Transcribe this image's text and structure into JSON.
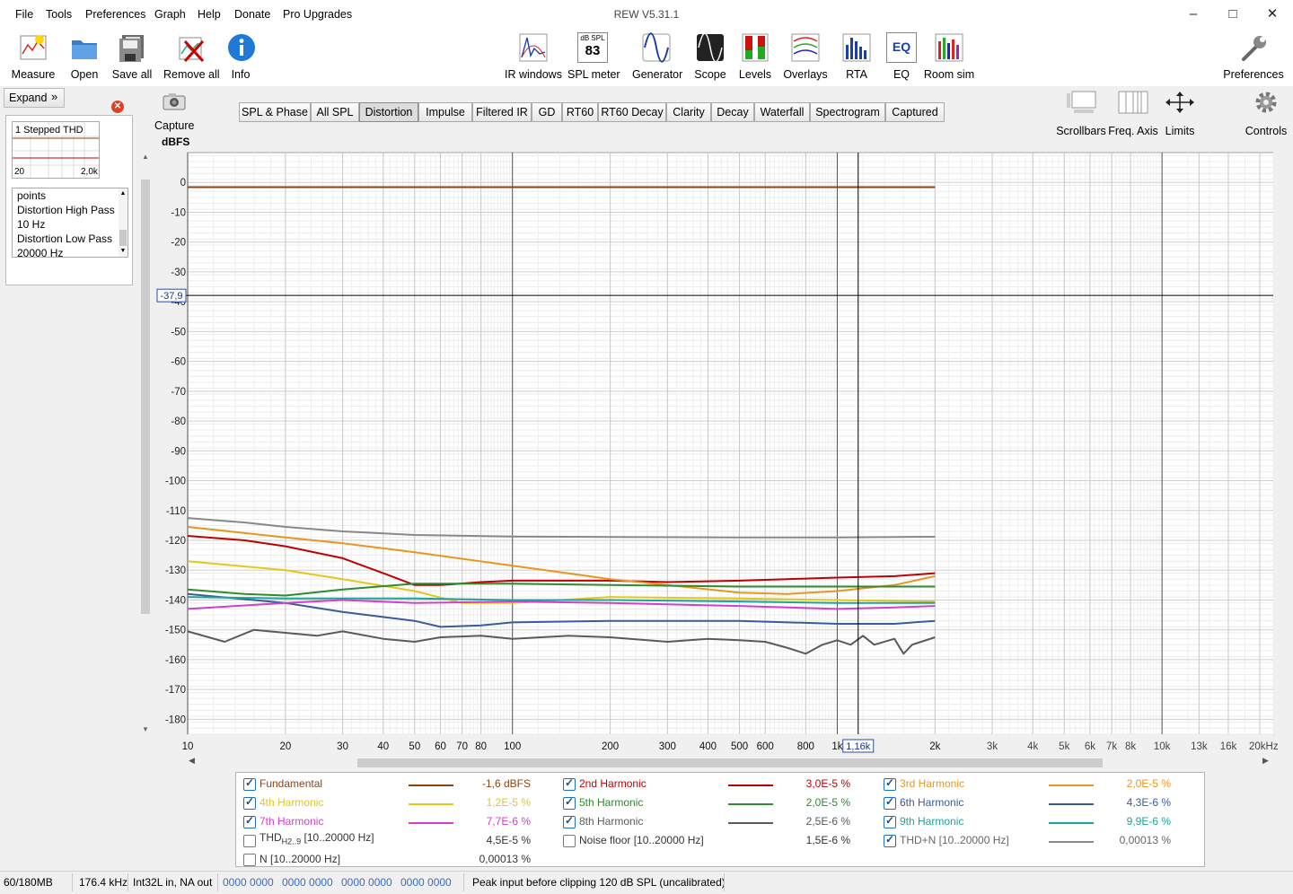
{
  "window": {
    "title": "REW V5.31.1",
    "menu": [
      "File",
      "Tools",
      "Preferences",
      "Graph",
      "Help",
      "Donate",
      "Pro Upgrades"
    ]
  },
  "toolbar": {
    "left": [
      "Measure",
      "Open",
      "Save all",
      "Remove all",
      "Info"
    ],
    "center": [
      "IR windows",
      "SPL meter",
      "Generator",
      "Scope",
      "Levels",
      "Overlays",
      "RTA",
      "EQ",
      "Room sim"
    ],
    "spl_icon_top": "dB SPL",
    "spl_icon_value": "83",
    "eq_icon": "EQ",
    "right": "Preferences"
  },
  "left_panel": {
    "expand": "Expand",
    "measurement_name": "1 Stepped THD",
    "thumb_x_left": "20",
    "thumb_x_right": "2,0k",
    "notes": [
      "points",
      "Distortion High Pass",
      "10 Hz",
      "Distortion Low Pass",
      "20000 Hz"
    ]
  },
  "capture": "Capture",
  "tabs": [
    "SPL & Phase",
    "All SPL",
    "Distortion",
    "Impulse",
    "Filtered IR",
    "GD",
    "RT60",
    "RT60 Decay",
    "Clarity",
    "Decay",
    "Waterfall",
    "Spectrogram",
    "Captured"
  ],
  "active_tab": "Distortion",
  "right_tools": [
    "Scrollbars",
    "Freq. Axis",
    "Limits",
    "Controls"
  ],
  "chart_data": {
    "type": "line",
    "ylabel": "dBFS",
    "xlabel": "",
    "x_scale": "log",
    "xlim": [
      10,
      22000
    ],
    "ylim": [
      -185,
      10
    ],
    "grid": true,
    "y_ticks": [
      "0",
      "-10",
      "-20",
      "-30",
      "-40",
      "-50",
      "-60",
      "-70",
      "-80",
      "-90",
      "-100",
      "-110",
      "-120",
      "-130",
      "-140",
      "-150",
      "-160",
      "-170",
      "-180"
    ],
    "x_ticks": [
      {
        "f": 10,
        "label": "10"
      },
      {
        "f": 20,
        "label": "20"
      },
      {
        "f": 30,
        "label": "30"
      },
      {
        "f": 40,
        "label": "40"
      },
      {
        "f": 50,
        "label": "50"
      },
      {
        "f": 60,
        "label": "60"
      },
      {
        "f": 70,
        "label": "70"
      },
      {
        "f": 80,
        "label": "80"
      },
      {
        "f": 100,
        "label": "100"
      },
      {
        "f": 200,
        "label": "200"
      },
      {
        "f": 300,
        "label": "300"
      },
      {
        "f": 400,
        "label": "400"
      },
      {
        "f": 500,
        "label": "500"
      },
      {
        "f": 600,
        "label": "600"
      },
      {
        "f": 800,
        "label": "800"
      },
      {
        "f": 1000,
        "label": "1k"
      },
      {
        "f": 2000,
        "label": "2k"
      },
      {
        "f": 3000,
        "label": "3k"
      },
      {
        "f": 4000,
        "label": "4k"
      },
      {
        "f": 5000,
        "label": "5k"
      },
      {
        "f": 6000,
        "label": "6k"
      },
      {
        "f": 7000,
        "label": "7k"
      },
      {
        "f": 8000,
        "label": "8k"
      },
      {
        "f": 10000,
        "label": "10k"
      },
      {
        "f": 13000,
        "label": "13k"
      },
      {
        "f": 16000,
        "label": "16k"
      },
      {
        "f": 20000,
        "label": "20kHz"
      }
    ],
    "cursor": {
      "freq": 1160,
      "freq_label": "1,16k",
      "level": -37.9,
      "level_label": "-37,9"
    },
    "series": [
      {
        "name": "Fundamental",
        "color": "#8b4513",
        "points": [
          [
            10,
            -1.6
          ],
          [
            2000,
            -1.6
          ]
        ]
      },
      {
        "name": "THD+N [10..20000 Hz]",
        "color": "#888888",
        "points": [
          [
            10,
            -112.5
          ],
          [
            15,
            -114
          ],
          [
            20,
            -115.5
          ],
          [
            30,
            -117
          ],
          [
            50,
            -118.2
          ],
          [
            100,
            -118.7
          ],
          [
            200,
            -118.9
          ],
          [
            500,
            -119
          ],
          [
            1000,
            -119
          ],
          [
            2000,
            -118.8
          ]
        ]
      },
      {
        "name": "2nd Harmonic",
        "color": "#c00000",
        "points": [
          [
            10,
            -118.5
          ],
          [
            15,
            -120
          ],
          [
            20,
            -122
          ],
          [
            30,
            -126
          ],
          [
            40,
            -131
          ],
          [
            50,
            -135
          ],
          [
            60,
            -135
          ],
          [
            80,
            -134
          ],
          [
            100,
            -133.5
          ],
          [
            200,
            -133.5
          ],
          [
            300,
            -134
          ],
          [
            500,
            -133.5
          ],
          [
            700,
            -133
          ],
          [
            1000,
            -132.5
          ],
          [
            1500,
            -132
          ],
          [
            2000,
            -131
          ]
        ]
      },
      {
        "name": "3rd Harmonic",
        "color": "#e8961e",
        "points": [
          [
            10,
            -115.5
          ],
          [
            20,
            -119
          ],
          [
            30,
            -121
          ],
          [
            50,
            -124
          ],
          [
            100,
            -128.5
          ],
          [
            200,
            -133
          ],
          [
            300,
            -135
          ],
          [
            500,
            -137.5
          ],
          [
            700,
            -138
          ],
          [
            1000,
            -137
          ],
          [
            1500,
            -135
          ],
          [
            2000,
            -132
          ]
        ]
      },
      {
        "name": "4th Harmonic",
        "color": "#e6c619",
        "points": [
          [
            10,
            -127
          ],
          [
            20,
            -130
          ],
          [
            30,
            -133
          ],
          [
            50,
            -137
          ],
          [
            70,
            -141
          ],
          [
            100,
            -141
          ],
          [
            200,
            -139
          ],
          [
            500,
            -139.5
          ],
          [
            1000,
            -140
          ],
          [
            2000,
            -140.5
          ]
        ]
      },
      {
        "name": "5th Harmonic",
        "color": "#2e8b2e",
        "points": [
          [
            10,
            -136.5
          ],
          [
            15,
            -138
          ],
          [
            20,
            -138.5
          ],
          [
            30,
            -136.5
          ],
          [
            50,
            -134.5
          ],
          [
            100,
            -134.5
          ],
          [
            200,
            -135
          ],
          [
            500,
            -135.5
          ],
          [
            1000,
            -135.5
          ],
          [
            2000,
            -135.5
          ]
        ]
      },
      {
        "name": "6th Harmonic",
        "color": "#3a5b9c",
        "points": [
          [
            10,
            -138
          ],
          [
            20,
            -141
          ],
          [
            30,
            -144
          ],
          [
            50,
            -147
          ],
          [
            60,
            -149
          ],
          [
            80,
            -148.5
          ],
          [
            100,
            -147.5
          ],
          [
            200,
            -147
          ],
          [
            500,
            -147
          ],
          [
            1000,
            -148
          ],
          [
            1500,
            -148
          ],
          [
            2000,
            -147
          ]
        ]
      },
      {
        "name": "7th Harmonic",
        "color": "#d33fc9",
        "points": [
          [
            10,
            -143
          ],
          [
            20,
            -141
          ],
          [
            30,
            -140
          ],
          [
            50,
            -141
          ],
          [
            100,
            -140.5
          ],
          [
            200,
            -141
          ],
          [
            500,
            -142
          ],
          [
            1000,
            -143
          ],
          [
            1500,
            -142.5
          ],
          [
            2000,
            -142
          ]
        ]
      },
      {
        "name": "9th Harmonic",
        "color": "#1ea59a",
        "points": [
          [
            10,
            -139
          ],
          [
            20,
            -139.5
          ],
          [
            30,
            -139.5
          ],
          [
            50,
            -139.5
          ],
          [
            100,
            -140
          ],
          [
            200,
            -140
          ],
          [
            500,
            -140.5
          ],
          [
            1000,
            -141
          ],
          [
            2000,
            -141
          ]
        ]
      },
      {
        "name": "8th Harmonic",
        "color": "#5a5a5a",
        "points": [
          [
            10,
            -150.5
          ],
          [
            13,
            -154
          ],
          [
            16,
            -150
          ],
          [
            20,
            -151
          ],
          [
            25,
            -152
          ],
          [
            30,
            -150.5
          ],
          [
            40,
            -153
          ],
          [
            50,
            -154
          ],
          [
            60,
            -152.5
          ],
          [
            80,
            -152
          ],
          [
            100,
            -153
          ],
          [
            150,
            -152
          ],
          [
            200,
            -152.5
          ],
          [
            300,
            -154
          ],
          [
            400,
            -153
          ],
          [
            500,
            -153.5
          ],
          [
            600,
            -154
          ],
          [
            700,
            -156
          ],
          [
            800,
            -158
          ],
          [
            900,
            -155
          ],
          [
            1000,
            -153.5
          ],
          [
            1100,
            -155
          ],
          [
            1200,
            -152
          ],
          [
            1300,
            -155
          ],
          [
            1500,
            -153
          ],
          [
            1600,
            -158
          ],
          [
            1700,
            -155
          ],
          [
            2000,
            -152.5
          ]
        ]
      }
    ]
  },
  "legend": [
    {
      "label": "Fundamental",
      "value": "-1,6 dBFS",
      "color": "#8b4513",
      "checked": true
    },
    {
      "label": "2nd Harmonic",
      "value": "3,0E-5 %",
      "color": "#c00000",
      "checked": true
    },
    {
      "label": "3rd Harmonic",
      "value": "2,0E-5 %",
      "color": "#e8961e",
      "checked": true
    },
    {
      "label": "4th Harmonic",
      "value": "1,2E-5 %",
      "color": "#e6c619",
      "checked": true
    },
    {
      "label": "5th Harmonic",
      "value": "2,0E-5 %",
      "color": "#2e8b2e",
      "checked": true
    },
    {
      "label": "6th Harmonic",
      "value": "4,3E-6 %",
      "color": "#3a5b9c",
      "checked": true
    },
    {
      "label": "7th Harmonic",
      "value": "7,7E-6 %",
      "color": "#d33fc9",
      "checked": true
    },
    {
      "label": "8th Harmonic",
      "value": "2,5E-6 %",
      "color": "#5a5a5a",
      "checked": true
    },
    {
      "label": "9th Harmonic",
      "value": "9,9E-6 %",
      "color": "#1ea59a",
      "checked": true
    },
    {
      "label": "THD",
      "sub": "H2..9",
      "label_suffix": " [10..20000 Hz]",
      "value": "4,5E-5 %",
      "color": "",
      "checked": false
    },
    {
      "label": "Noise floor [10..20000 Hz]",
      "value": "1,5E-6 %",
      "color": "",
      "checked": false
    },
    {
      "label": "THD+N [10..20000 Hz]",
      "value": "0,00013 %",
      "color": "#888888",
      "checked": true
    },
    {
      "label": "N [10..20000 Hz]",
      "value": "0,00013 %",
      "color": "",
      "checked": false
    }
  ],
  "statusbar": {
    "memory": "60/180MB",
    "rate": "176.4 kHz",
    "io": "Int32L in, NA out",
    "bits": [
      "0000 0000",
      "0000 0000",
      "0000 0000",
      "0000 0000"
    ],
    "message": "Peak input before clipping 120 dB SPL (uncalibrated)"
  }
}
